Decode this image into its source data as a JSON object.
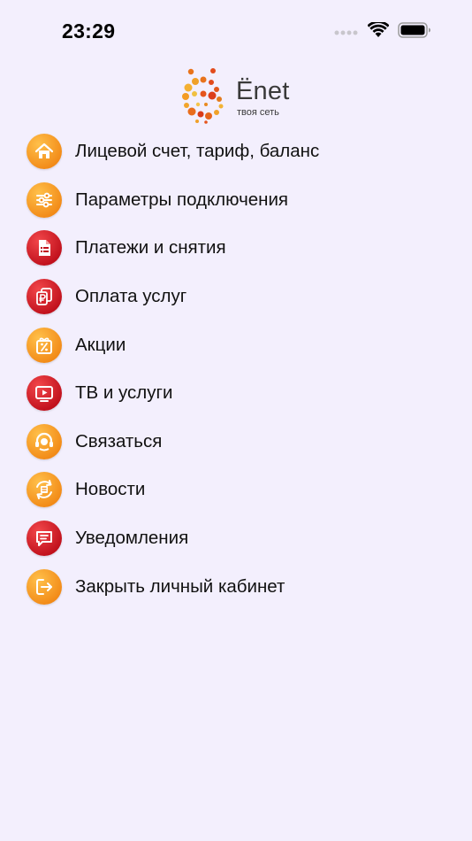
{
  "status_bar": {
    "time": "23:29"
  },
  "logo": {
    "name": "Ёnet",
    "tagline": "твоя сеть"
  },
  "colors": {
    "background": "#f3effd",
    "accent_orange": "#f28a17",
    "accent_red": "#c0101c"
  },
  "menu": {
    "items": [
      {
        "label": "Лицевой счет, тариф, баланс",
        "icon": "home-icon"
      },
      {
        "label": "Параметры подключения",
        "icon": "sliders-icon"
      },
      {
        "label": "Платежи и снятия",
        "icon": "document-icon"
      },
      {
        "label": "Оплата услуг",
        "icon": "ruble-cards-icon"
      },
      {
        "label": "Акции",
        "icon": "gift-percent-icon"
      },
      {
        "label": "ТВ и услуги",
        "icon": "tv-play-icon"
      },
      {
        "label": "Связаться",
        "icon": "headset-icon"
      },
      {
        "label": "Новости",
        "icon": "news-refresh-icon"
      },
      {
        "label": "Уведомления",
        "icon": "message-icon"
      },
      {
        "label": "Закрыть личный кабинет",
        "icon": "logout-icon"
      }
    ]
  }
}
